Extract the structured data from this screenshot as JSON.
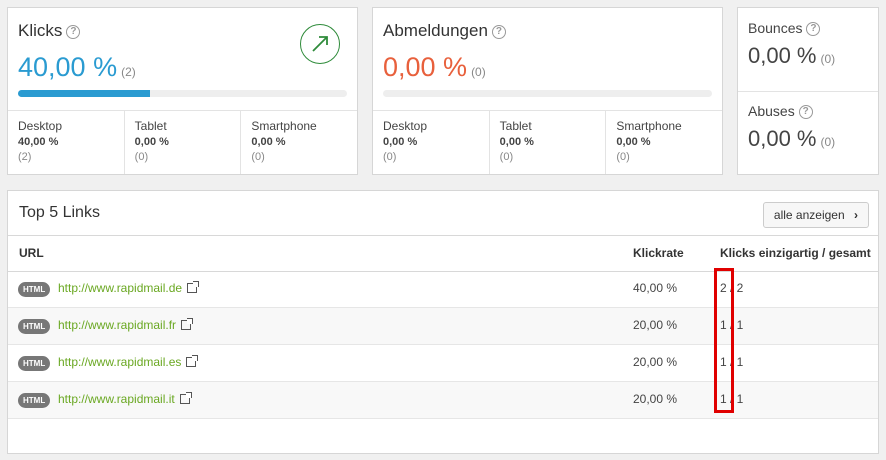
{
  "klicks": {
    "title": "Klicks",
    "value": "40,00 %",
    "count": "(2)",
    "progress": 0.4,
    "trend_icon": "arrow-up-right-icon",
    "devices": [
      {
        "name": "Desktop",
        "value": "40,00 %",
        "count": "(2)"
      },
      {
        "name": "Tablet",
        "value": "0,00 %",
        "count": "(0)"
      },
      {
        "name": "Smartphone",
        "value": "0,00 %",
        "count": "(0)"
      }
    ]
  },
  "abmeldungen": {
    "title": "Abmeldungen",
    "value": "0,00 %",
    "count": "(0)",
    "progress": 0,
    "devices": [
      {
        "name": "Desktop",
        "value": "0,00 %",
        "count": "(0)"
      },
      {
        "name": "Tablet",
        "value": "0,00 %",
        "count": "(0)"
      },
      {
        "name": "Smartphone",
        "value": "0,00 %",
        "count": "(0)"
      }
    ]
  },
  "bounces": {
    "title": "Bounces",
    "value": "0,00 %",
    "count": "(0)"
  },
  "abuses": {
    "title": "Abuses",
    "value": "0,00 %",
    "count": "(0)"
  },
  "links": {
    "title": "Top 5 Links",
    "button": "alle anzeigen",
    "headers": {
      "url": "URL",
      "rate": "Klickrate",
      "clicks": "Klicks einzigartig / gesamt"
    },
    "tag": "HTML",
    "rows": [
      {
        "url": "http://www.rapidmail.de",
        "rate": "40,00 %",
        "clicks": "2 / 2"
      },
      {
        "url": "http://www.rapidmail.fr",
        "rate": "20,00 %",
        "clicks": "1 / 1"
      },
      {
        "url": "http://www.rapidmail.es",
        "rate": "20,00 %",
        "clicks": "1 / 1"
      },
      {
        "url": "http://www.rapidmail.it",
        "rate": "20,00 %",
        "clicks": "1 / 1"
      }
    ]
  },
  "colors": {
    "accent_blue": "#2a9bd1",
    "accent_red": "#e8603c",
    "link_green": "#6aa822",
    "highlight": "#e00000"
  }
}
